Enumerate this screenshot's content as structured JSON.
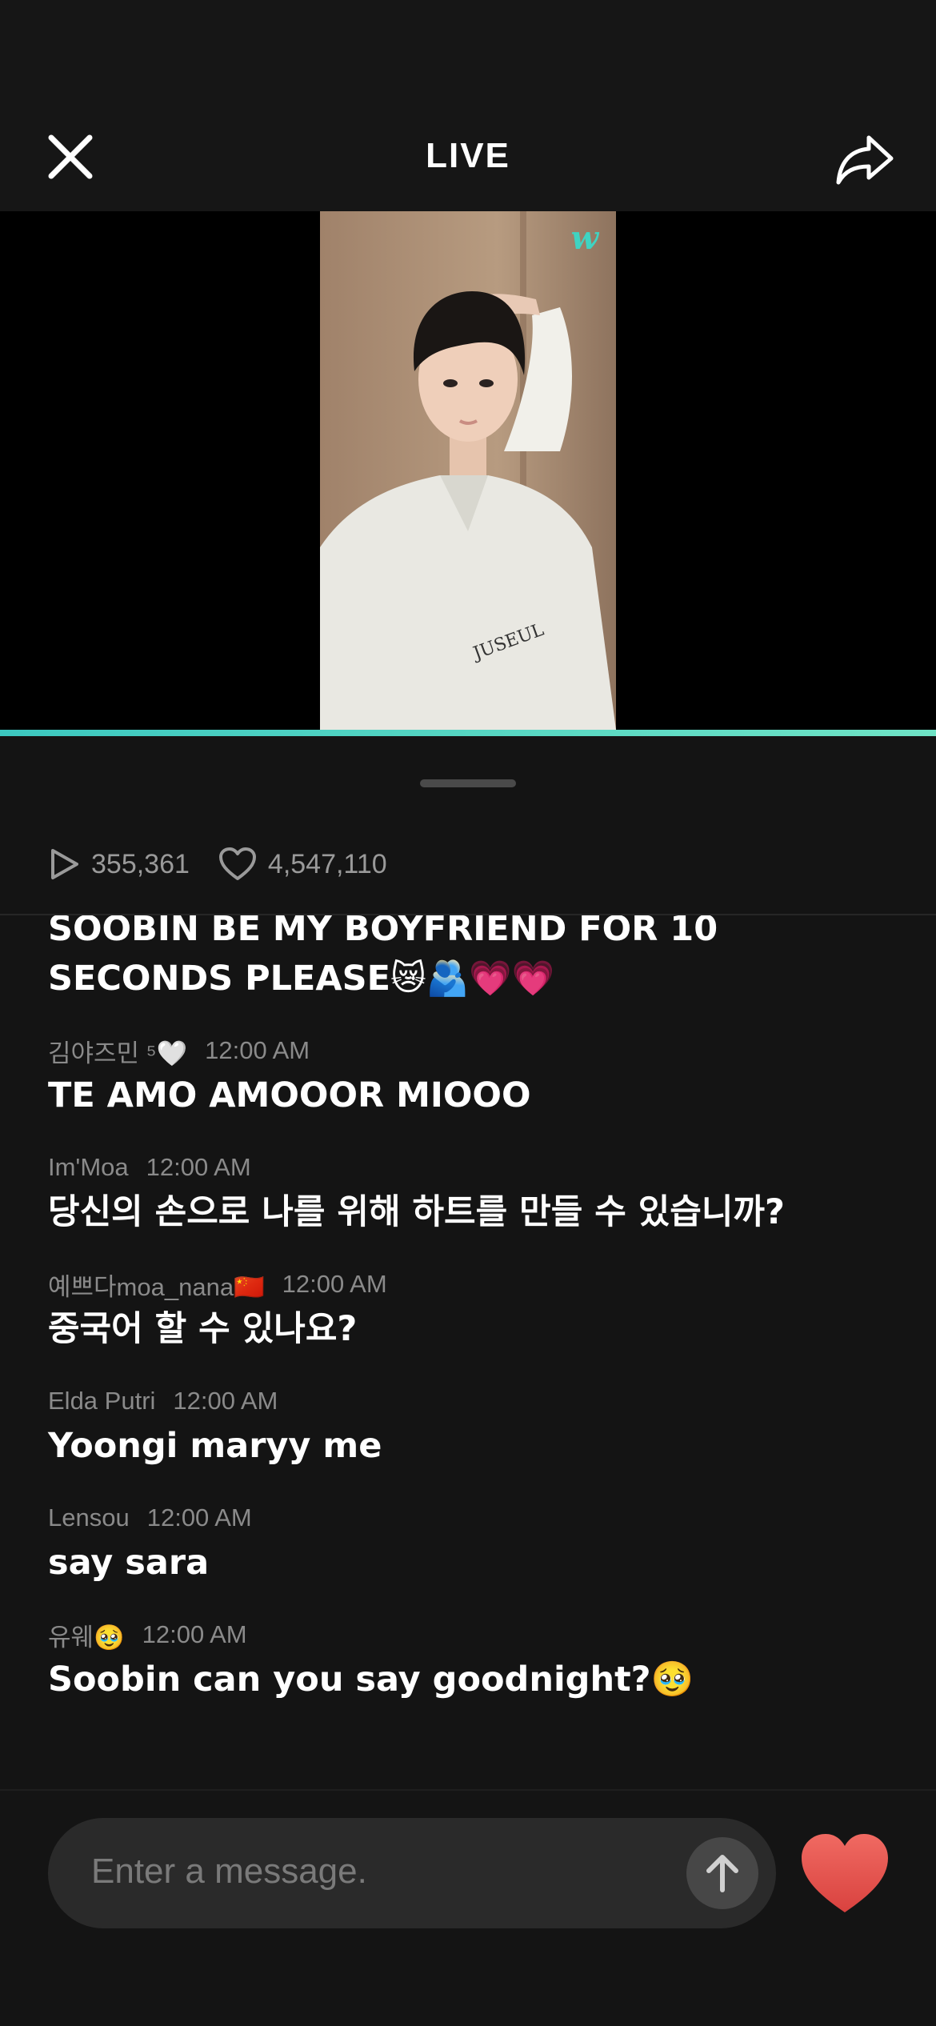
{
  "header": {
    "title": "LIVE",
    "close_icon": "close-icon",
    "share_icon": "share-icon"
  },
  "video": {
    "watermark": "w",
    "progress_color": "#3cc8c0"
  },
  "stats": {
    "views": "355,361",
    "likes": "4,547,110"
  },
  "chat": [
    {
      "user": "",
      "time": "",
      "text": "SOOBIN BE MY BOYFRIEND FOR 10 SECONDS PLEASE😿🫂💗💗"
    },
    {
      "user": "김야즈민 ⁵🤍",
      "time": "12:00 AM",
      "text": "TE AMO AMOOOR MIOOO"
    },
    {
      "user": "Im'Moa",
      "time": "12:00 AM",
      "text": "당신의 손으로 나를 위해 하트를 만들 수 있습니까?"
    },
    {
      "user": "예쁘다moa_nana🇨🇳",
      "time": "12:00 AM",
      "text": "중국어 할 수 있나요?"
    },
    {
      "user": "Elda Putri",
      "time": "12:00 AM",
      "text": "Yoongi maryy me"
    },
    {
      "user": "Lensou",
      "time": "12:00 AM",
      "text": "say sara"
    },
    {
      "user": "유웨🥹",
      "time": "12:00 AM",
      "text": "Soobin can you say goodnight?🥹"
    }
  ],
  "input": {
    "placeholder": "Enter a message."
  },
  "colors": {
    "accent": "#3cc8c0",
    "heart": "#e8504f",
    "background": "#141414"
  }
}
